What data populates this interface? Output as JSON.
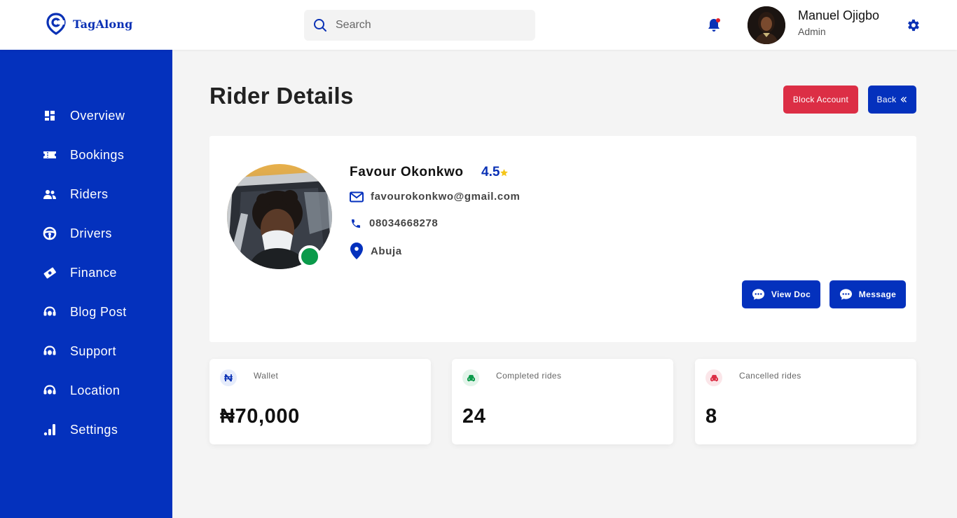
{
  "brand": {
    "name": "TagAlong"
  },
  "search": {
    "placeholder": "Search"
  },
  "user": {
    "name": "Manuel Ojigbo",
    "role": "Admin"
  },
  "sidebar": {
    "items": [
      {
        "label": "Overview",
        "icon": "dashboard-icon"
      },
      {
        "label": "Bookings",
        "icon": "ticket-icon"
      },
      {
        "label": "Riders",
        "icon": "users-icon"
      },
      {
        "label": "Drivers",
        "icon": "steering-wheel-icon"
      },
      {
        "label": "Finance",
        "icon": "money-icon"
      },
      {
        "label": "Blog Post",
        "icon": "headset-icon"
      },
      {
        "label": "Support",
        "icon": "headset-icon"
      },
      {
        "label": "Location",
        "icon": "headset-icon"
      },
      {
        "label": "Settings",
        "icon": "bar-chart-icon"
      }
    ]
  },
  "page": {
    "title": "Rider Details",
    "block_label": "Block Account",
    "back_label": "Back"
  },
  "rider": {
    "name": "Favour Okonkwo",
    "rating": "4.5",
    "email": "favourokonkwo@gmail.com",
    "phone": "08034668278",
    "location": "Abuja",
    "status": "online",
    "view_doc_label": "View Doc",
    "message_label": "Message"
  },
  "stats": [
    {
      "label": "Wallet",
      "value": "₦70,000",
      "icon": "naira-icon",
      "icon_color": "#0a31b5"
    },
    {
      "label": "Completed rides",
      "value": "24",
      "icon": "car-icon",
      "icon_color": "#0a9a4a"
    },
    {
      "label": "Cancelled rides",
      "value": "8",
      "icon": "car-icon",
      "icon_color": "#dc2e45"
    }
  ],
  "colors": {
    "primary": "#0431bd",
    "danger": "#dc2e45",
    "success": "#0a9a4a",
    "rating_star": "#f5c518",
    "background": "#f4f4f4"
  }
}
